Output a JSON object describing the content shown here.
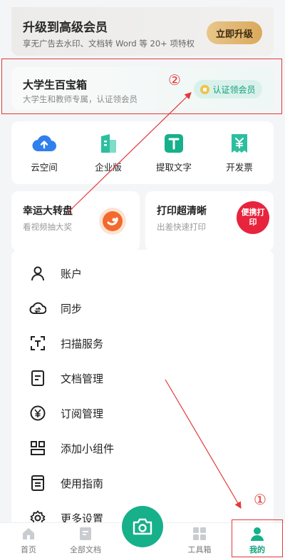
{
  "premium": {
    "title": "升级到高级会员",
    "subtitle": "享无广告去水印、文档转 Word 等 20+ 项特权",
    "button": "立即升级"
  },
  "student": {
    "title": "大学生百宝箱",
    "subtitle": "大学生和教师专属，认证领会员",
    "button": "认证领会员"
  },
  "annotations": {
    "num1": "①",
    "num2": "②"
  },
  "tools": [
    {
      "label": "云空间",
      "icon": "cloud-upload-icon"
    },
    {
      "label": "企业版",
      "icon": "building-icon"
    },
    {
      "label": "提取文字",
      "icon": "text-extract-icon"
    },
    {
      "label": "开发票",
      "icon": "invoice-icon"
    }
  ],
  "promos": {
    "lucky": {
      "title": "幸运大转盘",
      "subtitle": "看视频抽大奖"
    },
    "print": {
      "title": "打印超清晰",
      "subtitle": "出差快速打印",
      "badge": "便携打印"
    }
  },
  "menu": [
    {
      "label": "账户",
      "icon": "user-icon"
    },
    {
      "label": "同步",
      "icon": "sync-cloud-icon"
    },
    {
      "label": "扫描服务",
      "icon": "scan-text-icon"
    },
    {
      "label": "文档管理",
      "icon": "document-icon"
    },
    {
      "label": "订阅管理",
      "icon": "yen-circle-icon"
    },
    {
      "label": "添加小组件",
      "icon": "widget-grid-icon"
    },
    {
      "label": "使用指南",
      "icon": "guide-icon"
    },
    {
      "label": "更多设置",
      "icon": "gear-icon"
    }
  ],
  "nav": {
    "home": "首页",
    "docs": "全部文档",
    "tools": "工具箱",
    "mine": "我的"
  },
  "colors": {
    "accent": "#16b08a",
    "annotation": "#e23a3a"
  }
}
